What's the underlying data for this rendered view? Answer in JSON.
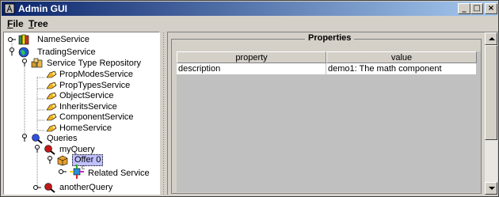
{
  "window": {
    "title": "Admin GUI",
    "min_label": "_",
    "max_label": "□",
    "close_label": "×"
  },
  "menu": {
    "file": {
      "mnemonic": "F",
      "rest": "ile"
    },
    "tree": {
      "mnemonic": "T",
      "rest": "ree"
    }
  },
  "tree": {
    "nodes": [
      {
        "label": "NameService",
        "icon": "books-icon"
      },
      {
        "label": "TradingService",
        "icon": "globe-icon"
      },
      {
        "label": "Service Type Repository",
        "icon": "cubes-icon"
      },
      {
        "label": "PropModesService",
        "icon": "key-icon"
      },
      {
        "label": "PropTypesService",
        "icon": "key-icon"
      },
      {
        "label": "ObjectService",
        "icon": "key-icon"
      },
      {
        "label": "InheritsService",
        "icon": "key-icon"
      },
      {
        "label": "ComponentService",
        "icon": "key-icon"
      },
      {
        "label": "HomeService",
        "icon": "key-icon"
      },
      {
        "label": "Queries",
        "icon": "magnifier-icon"
      },
      {
        "label": "myQuery",
        "icon": "magnifier-icon"
      },
      {
        "label": "Offer 0",
        "icon": "box-icon"
      },
      {
        "label": "Related Service",
        "icon": "component-icon"
      },
      {
        "label": "anotherQuery",
        "icon": "magnifier-icon"
      }
    ]
  },
  "properties": {
    "title": "Properties",
    "columns": [
      "property",
      "value"
    ],
    "rows": [
      {
        "property": "description",
        "value": "demo1: The math component"
      }
    ]
  }
}
